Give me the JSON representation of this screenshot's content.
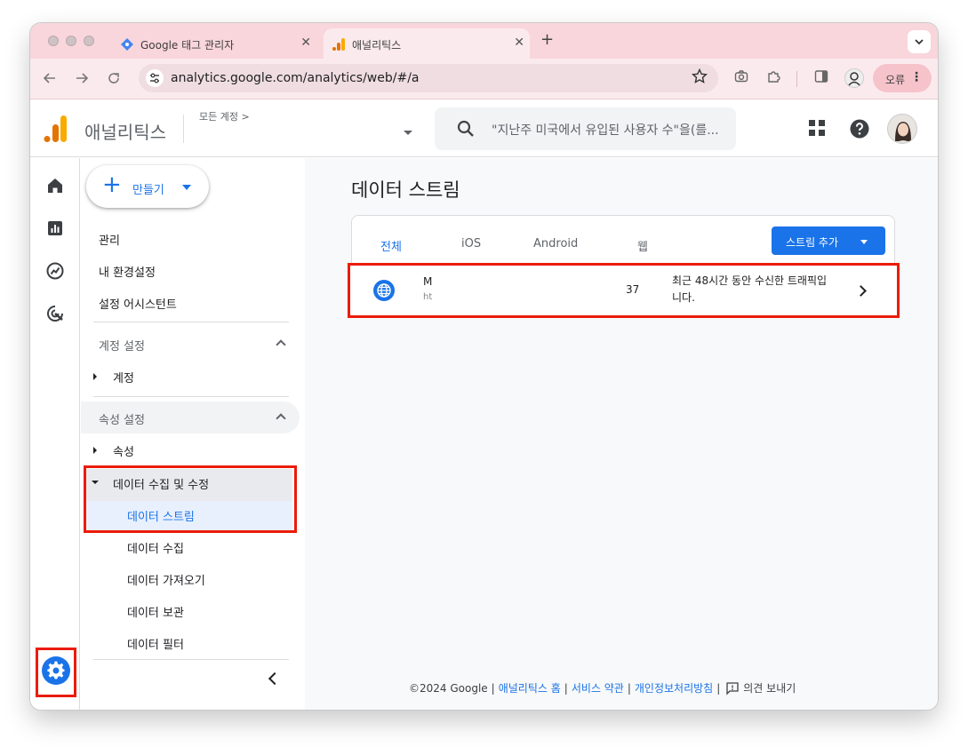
{
  "browser": {
    "tabs": [
      {
        "title": "Google 태그 관리자",
        "close": "✕"
      },
      {
        "title": "애널리틱스",
        "close": "✕"
      }
    ],
    "new_tab": "+",
    "url": "analytics.google.com/analytics/web/#/a",
    "error_button": "오류"
  },
  "header": {
    "brand": "애널리틱스",
    "account_crumb": "모든 계정 >",
    "search_placeholder": "\"지난주 미국에서 유입된 사용자 수\"을(를..."
  },
  "admin_nav": {
    "create_label": "만들기",
    "items": [
      "관리",
      "내 환경설정",
      "설정 어시스턴트"
    ],
    "account_section": "계정 설정",
    "account_item": "계정",
    "property_section": "속성 설정",
    "property_item": "속성",
    "collect_group": "데이터 수집 및 수정",
    "sub_items": [
      "데이터 스트림",
      "데이터 수집",
      "데이터 가져오기",
      "데이터 보관",
      "데이터 필터"
    ]
  },
  "main": {
    "page_title": "데이터 스트림",
    "filter_tabs": [
      "전체",
      "iOS",
      "Android",
      "웹"
    ],
    "add_stream": "스트림 추가",
    "stream": {
      "name": "M",
      "url": "ht",
      "id": "37",
      "status": "최근 48시간 동안 수신한 트래픽입니다."
    },
    "footer": {
      "copyright": "©2024 Google",
      "links": [
        "애널리틱스 홈",
        "서비스 약관",
        "개인정보처리방침"
      ],
      "feedback": "의견 보내기"
    }
  },
  "colors": {
    "accent": "#1a73e8",
    "highlight_box": "#ea1c0a",
    "tab_strip": "#f9d6dc"
  }
}
